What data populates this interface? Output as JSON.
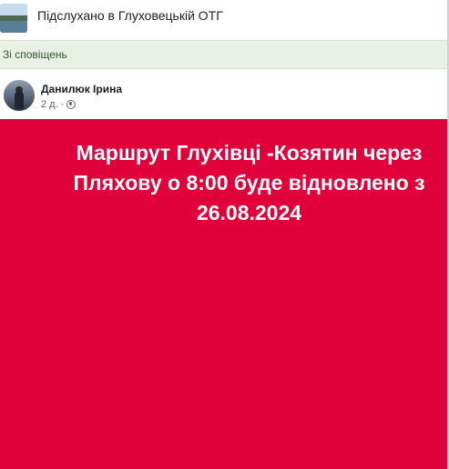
{
  "group": {
    "name": "Підслухано в Глуховецькій ОТГ"
  },
  "notifications": {
    "label": "Зі сповіщень"
  },
  "post": {
    "author": "Данилюк Ірина",
    "time": "2 д.",
    "separator": "·",
    "privacy_icon": "globe-icon",
    "image_background": "#e0003a",
    "text_lines": [
      "Маршрут Глухівці -Козятин через",
      "Пляхову о 8:00 буде відновлено з",
      "26.08.2024"
    ]
  }
}
